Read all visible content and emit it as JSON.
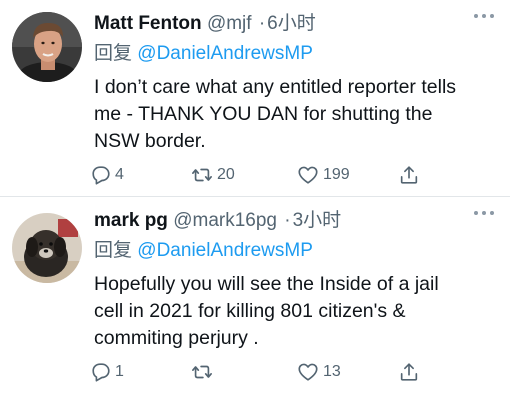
{
  "tweets": [
    {
      "name": "Matt Fenton",
      "handle": "@mjf",
      "separator": "·",
      "time": "6小时",
      "reply_prefix": "回复",
      "reply_to": "@DanielAndrewsMP",
      "body_lines": [
        "I don’t care what any entitled reporter tells",
        "me - THANK YOU DAN for shutting the",
        "NSW border."
      ],
      "replies": "4",
      "retweets": "20",
      "likes": "199",
      "avatar": "man-portrait"
    },
    {
      "name": "mark pg",
      "handle": "@mark16pg",
      "separator": "·",
      "time": "3小时",
      "reply_prefix": "回复",
      "reply_to": "@DanielAndrewsMP",
      "body_lines": [
        "Hopefully you will see the Inside of a jail",
        "cell in 2021 for killing 801 citizen's &",
        "commiting perjury ."
      ],
      "replies": "1",
      "retweets": "",
      "likes": "13",
      "avatar": "dog-photo"
    }
  ],
  "icons": {
    "reply": "reply-icon",
    "retweet": "retweet-icon",
    "like": "heart-icon",
    "share": "share-icon",
    "more": "more-icon"
  },
  "colors": {
    "link": "#1d9bf0",
    "secondary_text": "#536471",
    "primary_text": "#0f1419"
  }
}
